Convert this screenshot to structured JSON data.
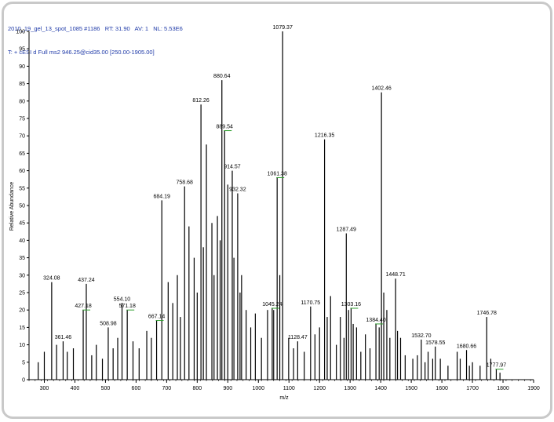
{
  "header": {
    "line1": "2010_19_gel_13_spot_1085 #1186   RT: 31.90   AV: 1   NL: 5.53E6",
    "line2": "T: + cESI d Full ms2 946.25@cid35.00 [250.00-1905.00]"
  },
  "colors": {
    "frame": "#c9c9c9",
    "header_text": "#1f3aa8",
    "peaks": "#000000",
    "annotation_tick": "#2e9e2e"
  },
  "chart_data": {
    "type": "bar",
    "title": "",
    "xlabel": "m/z",
    "ylabel": "Relative Abundance",
    "xlim": [
      250,
      1900
    ],
    "ylim": [
      0,
      100
    ],
    "x_ticks": [
      300,
      400,
      500,
      600,
      700,
      800,
      900,
      1000,
      1100,
      1200,
      1300,
      1400,
      1500,
      1600,
      1700,
      1800,
      1900
    ],
    "y_ticks": [
      0,
      5,
      10,
      15,
      20,
      25,
      30,
      35,
      40,
      45,
      50,
      55,
      60,
      65,
      70,
      75,
      80,
      85,
      90,
      95,
      100
    ],
    "grid": false,
    "labeled_peaks": [
      {
        "label": "324.08",
        "mz": 324.08,
        "intensity": 28
      },
      {
        "label": "361.46",
        "mz": 361.46,
        "intensity": 11
      },
      {
        "label": "427.18",
        "mz": 427.18,
        "intensity": 20,
        "tick": true
      },
      {
        "label": "437.24",
        "mz": 437.24,
        "intensity": 27.5
      },
      {
        "label": "508.98",
        "mz": 508.98,
        "intensity": 15
      },
      {
        "label": "554.10",
        "mz": 554.1,
        "intensity": 22
      },
      {
        "label": "571.18",
        "mz": 571.18,
        "intensity": 20,
        "tick": true
      },
      {
        "label": "667.14",
        "mz": 667.14,
        "intensity": 17,
        "tick": true
      },
      {
        "label": "684.19",
        "mz": 684.19,
        "intensity": 51.5
      },
      {
        "label": "758.68",
        "mz": 758.68,
        "intensity": 55.5
      },
      {
        "label": "812.26",
        "mz": 812.26,
        "intensity": 79
      },
      {
        "label": "880.64",
        "mz": 880.64,
        "intensity": 86
      },
      {
        "label": "889.54",
        "mz": 889.54,
        "intensity": 71.5,
        "tick": true
      },
      {
        "label": "914.57",
        "mz": 914.57,
        "intensity": 60
      },
      {
        "label": "932.32",
        "mz": 932.32,
        "intensity": 53.5
      },
      {
        "label": "1045.24",
        "mz": 1045.24,
        "intensity": 20.5,
        "tick": true
      },
      {
        "label": "1061.38",
        "mz": 1061.38,
        "intensity": 58,
        "tick": true
      },
      {
        "label": "1079.37",
        "mz": 1079.37,
        "intensity": 100
      },
      {
        "label": "1128.47",
        "mz": 1128.47,
        "intensity": 11
      },
      {
        "label": "1170.75",
        "mz": 1170.75,
        "intensity": 21
      },
      {
        "label": "1216.35",
        "mz": 1216.35,
        "intensity": 69
      },
      {
        "label": "1287.49",
        "mz": 1287.49,
        "intensity": 42
      },
      {
        "label": "1303.16",
        "mz": 1303.16,
        "intensity": 20.5,
        "tick": true
      },
      {
        "label": "1384.40",
        "mz": 1384.4,
        "intensity": 16,
        "tick": true
      },
      {
        "label": "1402.46",
        "mz": 1402.46,
        "intensity": 82.5
      },
      {
        "label": "1448.71",
        "mz": 1448.71,
        "intensity": 29
      },
      {
        "label": "1532.70",
        "mz": 1532.7,
        "intensity": 11.5
      },
      {
        "label": "1578.55",
        "mz": 1578.55,
        "intensity": 9.5
      },
      {
        "label": "1680.66",
        "mz": 1680.66,
        "intensity": 8.5
      },
      {
        "label": "1746.78",
        "mz": 1746.78,
        "intensity": 18
      },
      {
        "label": "1777.97",
        "mz": 1777.97,
        "intensity": 3,
        "tick": true
      }
    ],
    "unlabeled_peaks": [
      {
        "mz": 735,
        "intensity": 30
      },
      {
        "mz": 773,
        "intensity": 44
      },
      {
        "mz": 790,
        "intensity": 35
      },
      {
        "mz": 830,
        "intensity": 67.5
      },
      {
        "mz": 848,
        "intensity": 45
      },
      {
        "mz": 866,
        "intensity": 47
      },
      {
        "mz": 900,
        "intensity": 56
      },
      {
        "mz": 945,
        "intensity": 30
      },
      {
        "mz": 960,
        "intensity": 20
      },
      {
        "mz": 990,
        "intensity": 19
      },
      {
        "mz": 1030,
        "intensity": 20
      },
      {
        "mz": 1099,
        "intensity": 12
      },
      {
        "mz": 1185,
        "intensity": 13
      },
      {
        "mz": 1236,
        "intensity": 24
      },
      {
        "mz": 1268,
        "intensity": 18
      },
      {
        "mz": 1321,
        "intensity": 15
      },
      {
        "mz": 1350,
        "intensity": 13
      },
      {
        "mz": 1420,
        "intensity": 20
      },
      {
        "mz": 1465,
        "intensity": 12
      },
      {
        "mz": 1480,
        "intensity": 7
      },
      {
        "mz": 1505,
        "intensity": 6
      },
      {
        "mz": 1555,
        "intensity": 8
      },
      {
        "mz": 1595,
        "intensity": 6
      },
      {
        "mz": 1620,
        "intensity": 4
      },
      {
        "mz": 1650,
        "intensity": 8
      },
      {
        "mz": 1700,
        "intensity": 5
      },
      {
        "mz": 1725,
        "intensity": 4
      },
      {
        "mz": 1760,
        "intensity": 6
      },
      {
        "mz": 1790,
        "intensity": 2
      },
      {
        "mz": 280,
        "intensity": 5
      },
      {
        "mz": 300,
        "intensity": 8
      },
      {
        "mz": 340,
        "intensity": 10
      },
      {
        "mz": 375,
        "intensity": 8
      },
      {
        "mz": 395,
        "intensity": 9
      },
      {
        "mz": 455,
        "intensity": 7
      },
      {
        "mz": 470,
        "intensity": 10
      },
      {
        "mz": 490,
        "intensity": 6
      },
      {
        "mz": 525,
        "intensity": 9
      },
      {
        "mz": 540,
        "intensity": 12
      },
      {
        "mz": 590,
        "intensity": 11
      },
      {
        "mz": 610,
        "intensity": 9
      },
      {
        "mz": 635,
        "intensity": 14
      },
      {
        "mz": 650,
        "intensity": 12
      },
      {
        "mz": 705,
        "intensity": 28
      },
      {
        "mz": 720,
        "intensity": 22
      },
      {
        "mz": 745,
        "intensity": 18
      },
      {
        "mz": 800,
        "intensity": 25
      },
      {
        "mz": 820,
        "intensity": 38
      },
      {
        "mz": 855,
        "intensity": 30
      },
      {
        "mz": 875,
        "intensity": 40
      },
      {
        "mz": 920,
        "intensity": 35
      },
      {
        "mz": 940,
        "intensity": 25
      },
      {
        "mz": 975,
        "intensity": 15
      },
      {
        "mz": 1010,
        "intensity": 12
      },
      {
        "mz": 1050,
        "intensity": 20
      },
      {
        "mz": 1070,
        "intensity": 30
      },
      {
        "mz": 1115,
        "intensity": 9
      },
      {
        "mz": 1150,
        "intensity": 8
      },
      {
        "mz": 1200,
        "intensity": 15
      },
      {
        "mz": 1225,
        "intensity": 18
      },
      {
        "mz": 1255,
        "intensity": 10
      },
      {
        "mz": 1280,
        "intensity": 12
      },
      {
        "mz": 1295,
        "intensity": 20
      },
      {
        "mz": 1310,
        "intensity": 16
      },
      {
        "mz": 1335,
        "intensity": 8
      },
      {
        "mz": 1365,
        "intensity": 9
      },
      {
        "mz": 1395,
        "intensity": 15
      },
      {
        "mz": 1410,
        "intensity": 25
      },
      {
        "mz": 1430,
        "intensity": 12
      },
      {
        "mz": 1455,
        "intensity": 14
      },
      {
        "mz": 1520,
        "intensity": 7
      },
      {
        "mz": 1545,
        "intensity": 5
      },
      {
        "mz": 1570,
        "intensity": 6
      },
      {
        "mz": 1660,
        "intensity": 6
      },
      {
        "mz": 1690,
        "intensity": 4
      }
    ]
  }
}
